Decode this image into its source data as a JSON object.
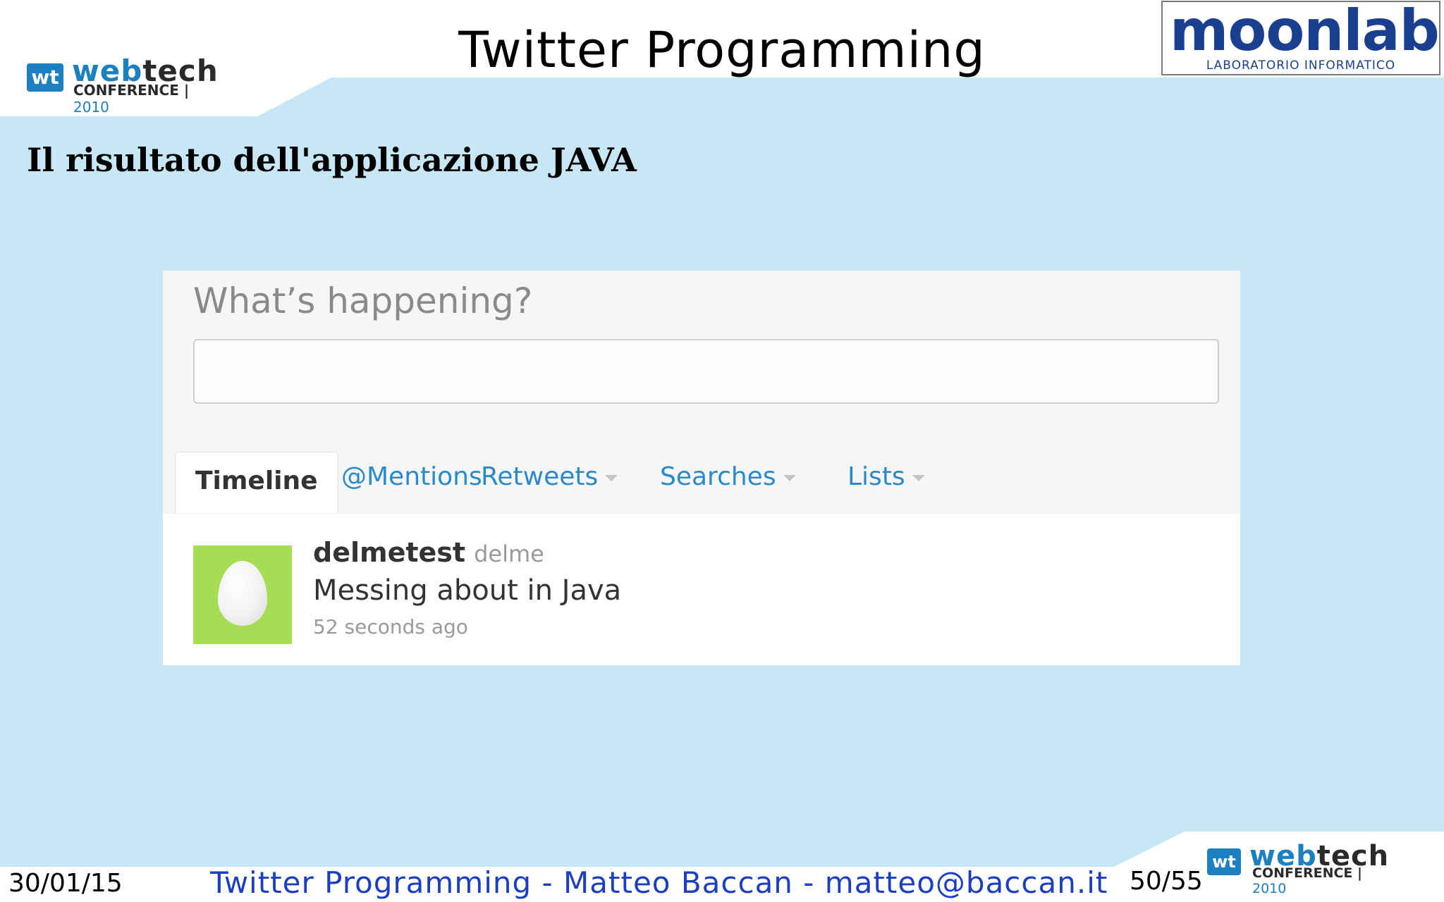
{
  "slide": {
    "title": "Twitter Programming",
    "heading": "Il risultato dell'applicazione JAVA"
  },
  "logos": {
    "webtech": {
      "web": "web",
      "tech": "tech",
      "badge": "wt",
      "conference": "CONFERENCE",
      "year": "2010"
    },
    "moonlab": {
      "name": "moonlab",
      "subtitle": "LABORATORIO INFORMATICO"
    }
  },
  "twitter": {
    "prompt": "What’s happening?",
    "input_value": "",
    "tabs": [
      {
        "label": "Timeline",
        "active": true,
        "dropdown": false
      },
      {
        "label": "@Mentions",
        "active": false,
        "dropdown": false
      },
      {
        "label": "Retweets",
        "active": false,
        "dropdown": true
      },
      {
        "label": "Searches",
        "active": false,
        "dropdown": true
      },
      {
        "label": "Lists",
        "active": false,
        "dropdown": true
      }
    ],
    "tweet": {
      "avatar_icon": "egg-avatar-icon",
      "username": "delmetest",
      "handle": "delme",
      "text": "Messing about in Java",
      "time": "52 seconds ago"
    }
  },
  "footer": {
    "date": "30/01/15",
    "center": "Twitter Programming - Matteo Baccan - matteo@baccan.it",
    "page": "50/55"
  },
  "colors": {
    "background": "#c8e7f6",
    "accent_blue": "#1b7fc0",
    "link_blue": "#2a8ac8",
    "avatar_green": "#a5de55",
    "footer_text": "#1b3fc0"
  }
}
